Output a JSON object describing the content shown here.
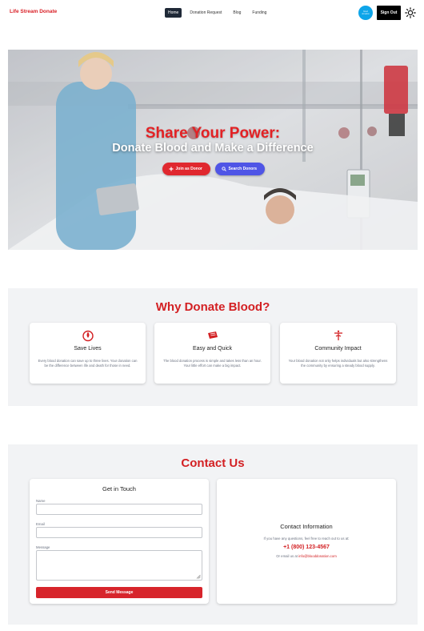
{
  "nav": {
    "brand": "Life Stream Donate",
    "links": [
      "Home",
      "Donation Request",
      "Blog",
      "Funding"
    ],
    "active_link": "Home",
    "avatar_text": "blood donation",
    "signout_label": "Sign Out",
    "theme_icon": "sun-icon"
  },
  "hero": {
    "title": "Share Your Power:",
    "subtitle": "Donate Blood and Make a Difference",
    "primary_button": "Join as Donor",
    "secondary_button": "Search Donors",
    "primary_icon": "plus-icon",
    "secondary_icon": "search-icon"
  },
  "why": {
    "heading": "Why Donate Blood?",
    "cards": [
      {
        "icon": "blood-drop-icon",
        "title": "Save Lives",
        "text": "Every blood donation can save up to three lives. Your donation can be the difference between life and death for those in need."
      },
      {
        "icon": "ticket-icon",
        "title": "Easy and Quick",
        "text": "The blood donation process is simple and takes less than an hour. Your little effort can make a big impact."
      },
      {
        "icon": "community-icon",
        "title": "Community Impact",
        "text": "Your blood donation not only helps individuals but also strengthens the community by ensuring a steady blood supply."
      }
    ]
  },
  "contact": {
    "heading": "Contact Us",
    "form": {
      "title": "Get in Touch",
      "name_label": "Name",
      "email_label": "Email",
      "message_label": "Message",
      "name_value": "",
      "email_value": "",
      "message_value": "",
      "submit_label": "Send Message"
    },
    "info": {
      "title": "Contact Information",
      "prompt": "If you have any questions, feel free to reach out to us at:",
      "phone": "+1 (800) 123-4567",
      "email_prefix": "Or email us at ",
      "email": "info@blooddonation.com"
    }
  },
  "colors": {
    "brand_red": "#d92027",
    "accent_blue": "#4f55e6",
    "nav_active": "#1f2937",
    "section_bg": "#f2f3f5"
  }
}
